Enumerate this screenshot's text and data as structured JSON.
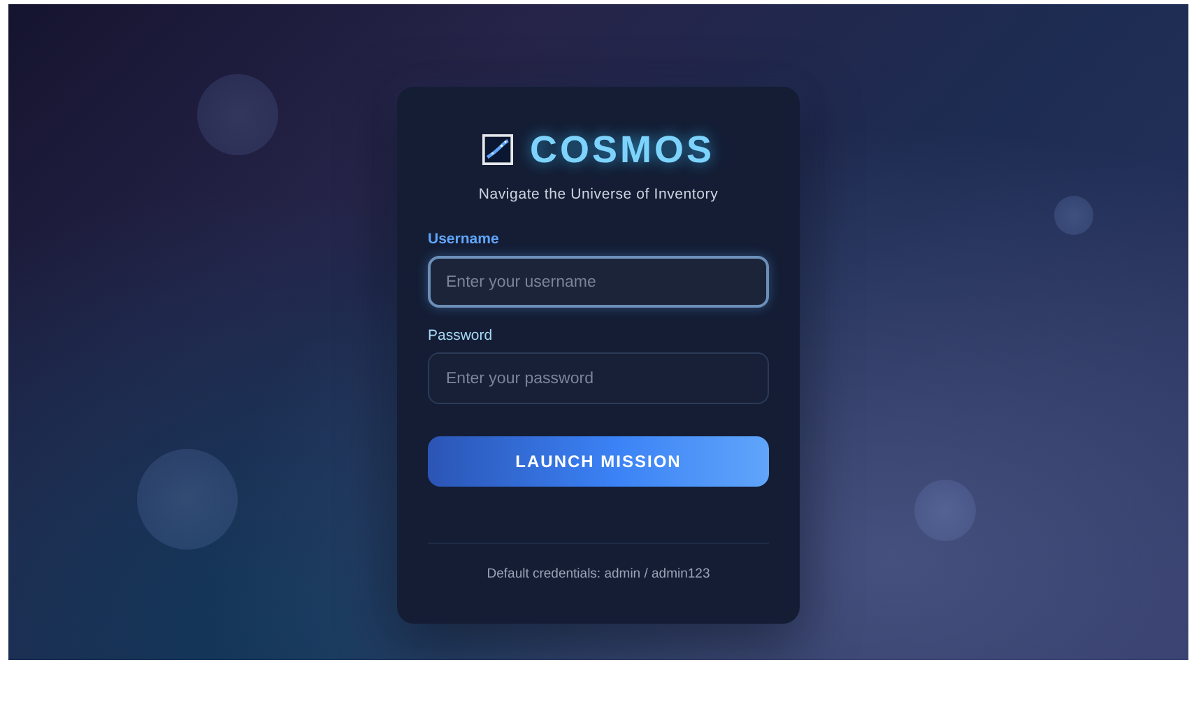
{
  "brand": {
    "title": "COSMOS",
    "tagline": "Navigate the Universe of Inventory"
  },
  "fields": [
    {
      "label": "Username",
      "placeholder": "Enter your username",
      "focused": true
    },
    {
      "label": "Password",
      "placeholder": "Enter your password",
      "focused": false
    }
  ],
  "submit_button": "LAUNCH MISSION",
  "footer": "Default credentials: admin / admin123"
}
